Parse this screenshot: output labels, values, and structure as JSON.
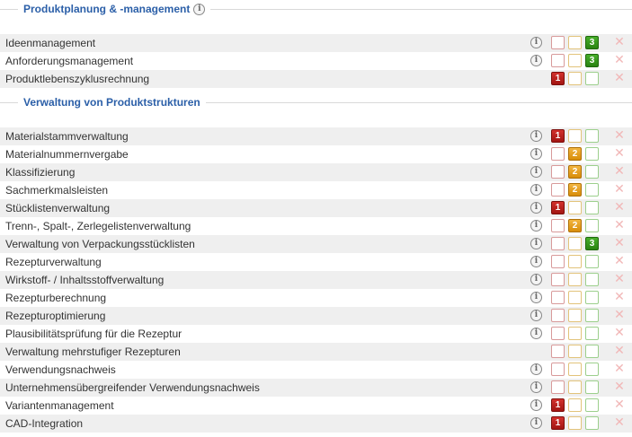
{
  "sections": [
    {
      "title": "Produktplanung & -management",
      "rows": [
        {
          "label": "Ideenmanagement",
          "info": true,
          "level": 3
        },
        {
          "label": "Anforderungsmanagement",
          "info": true,
          "level": 3
        },
        {
          "label": "Produktlebenszyklusrechnung",
          "info": false,
          "level": 1
        }
      ]
    },
    {
      "title": "Verwaltung von Produktstrukturen",
      "rows": [
        {
          "label": "Materialstammverwaltung",
          "info": true,
          "level": 1
        },
        {
          "label": "Materialnummernvergabe",
          "info": true,
          "level": 2
        },
        {
          "label": "Klassifizierung",
          "info": true,
          "level": 2
        },
        {
          "label": "Sachmerkmalsleisten",
          "info": true,
          "level": 2
        },
        {
          "label": "Stücklistenverwaltung",
          "info": true,
          "level": 1
        },
        {
          "label": "Trenn-, Spalt-, Zerlegelistenverwaltung",
          "info": true,
          "level": 2
        },
        {
          "label": "Verwaltung von Verpackungsstücklisten",
          "info": true,
          "level": 3
        },
        {
          "label": "Rezepturverwaltung",
          "info": true,
          "level": 0
        },
        {
          "label": "Wirkstoff- / Inhaltsstoffverwaltung",
          "info": true,
          "level": 0
        },
        {
          "label": "Rezepturberechnung",
          "info": true,
          "level": 0
        },
        {
          "label": "Rezepturoptimierung",
          "info": true,
          "level": 0
        },
        {
          "label": "Plausibilitätsprüfung für die Rezeptur",
          "info": true,
          "level": 0
        },
        {
          "label": "Verwaltung mehrstufiger Rezepturen",
          "info": false,
          "level": 0
        },
        {
          "label": "Verwendungsnachweis",
          "info": true,
          "level": 0
        },
        {
          "label": "Unternehmensübergreifender Verwendungsnachweis",
          "info": true,
          "level": 0
        },
        {
          "label": "Variantenmanagement",
          "info": true,
          "level": 1
        },
        {
          "label": "CAD-Integration",
          "info": true,
          "level": 1
        }
      ]
    }
  ],
  "icons": {
    "info": "info-icon",
    "remove": "close-icon"
  },
  "colors": {
    "section_title": "#2b5fa8",
    "level_1": "#c0221f",
    "level_2": "#e6a020",
    "level_3": "#3a9a1e",
    "remove": "#f1b7b7"
  }
}
